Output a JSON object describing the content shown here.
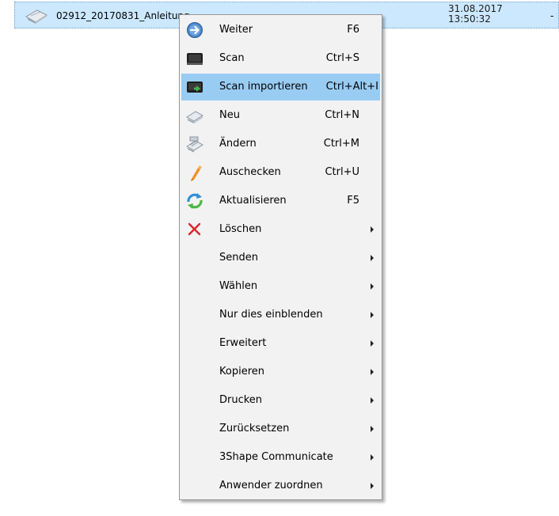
{
  "file_list": {
    "selected_row": {
      "name": "02912_20170831_Anleitung",
      "date": "31.08.2017",
      "time": "13:50:32",
      "extra": "-",
      "icon": "document-scan-icon"
    }
  },
  "context_menu": {
    "items": [
      {
        "label": "Weiter",
        "shortcut": "F6",
        "icon": "arrow-right-circle-icon"
      },
      {
        "label": "Scan",
        "shortcut": "Ctrl+S",
        "icon": "scanner-icon"
      },
      {
        "label": "Scan importieren",
        "shortcut": "Ctrl+Alt+I",
        "icon": "scanner-import-icon",
        "highlighted": true
      },
      {
        "label": "Neu",
        "shortcut": "Ctrl+N",
        "icon": "new-document-icon"
      },
      {
        "label": "Ändern",
        "shortcut": "Ctrl+M",
        "icon": "edit-document-icon"
      },
      {
        "label": "Auschecken",
        "shortcut": "Ctrl+U",
        "icon": "checkout-icon"
      },
      {
        "label": "Aktualisieren",
        "shortcut": "F5",
        "icon": "refresh-icon"
      },
      {
        "label": "Löschen",
        "submenu": true,
        "icon": "delete-x-icon"
      },
      {
        "label": "Senden",
        "submenu": true
      },
      {
        "label": "Wählen",
        "submenu": true
      },
      {
        "label": "Nur dies einblenden",
        "submenu": true
      },
      {
        "label": "Erweitert",
        "submenu": true
      },
      {
        "label": "Kopieren",
        "submenu": true
      },
      {
        "label": "Drucken",
        "submenu": true
      },
      {
        "label": "Zurücksetzen",
        "submenu": true
      },
      {
        "label": "3Shape Communicate",
        "submenu": true
      },
      {
        "label": "Anwender zuordnen",
        "submenu": true
      }
    ]
  },
  "colors": {
    "row_selected_bg": "#cce8ff",
    "menu_bg": "#f2f2f2",
    "menu_highlight": "#99ccf3",
    "delete_red": "#d9262b"
  }
}
